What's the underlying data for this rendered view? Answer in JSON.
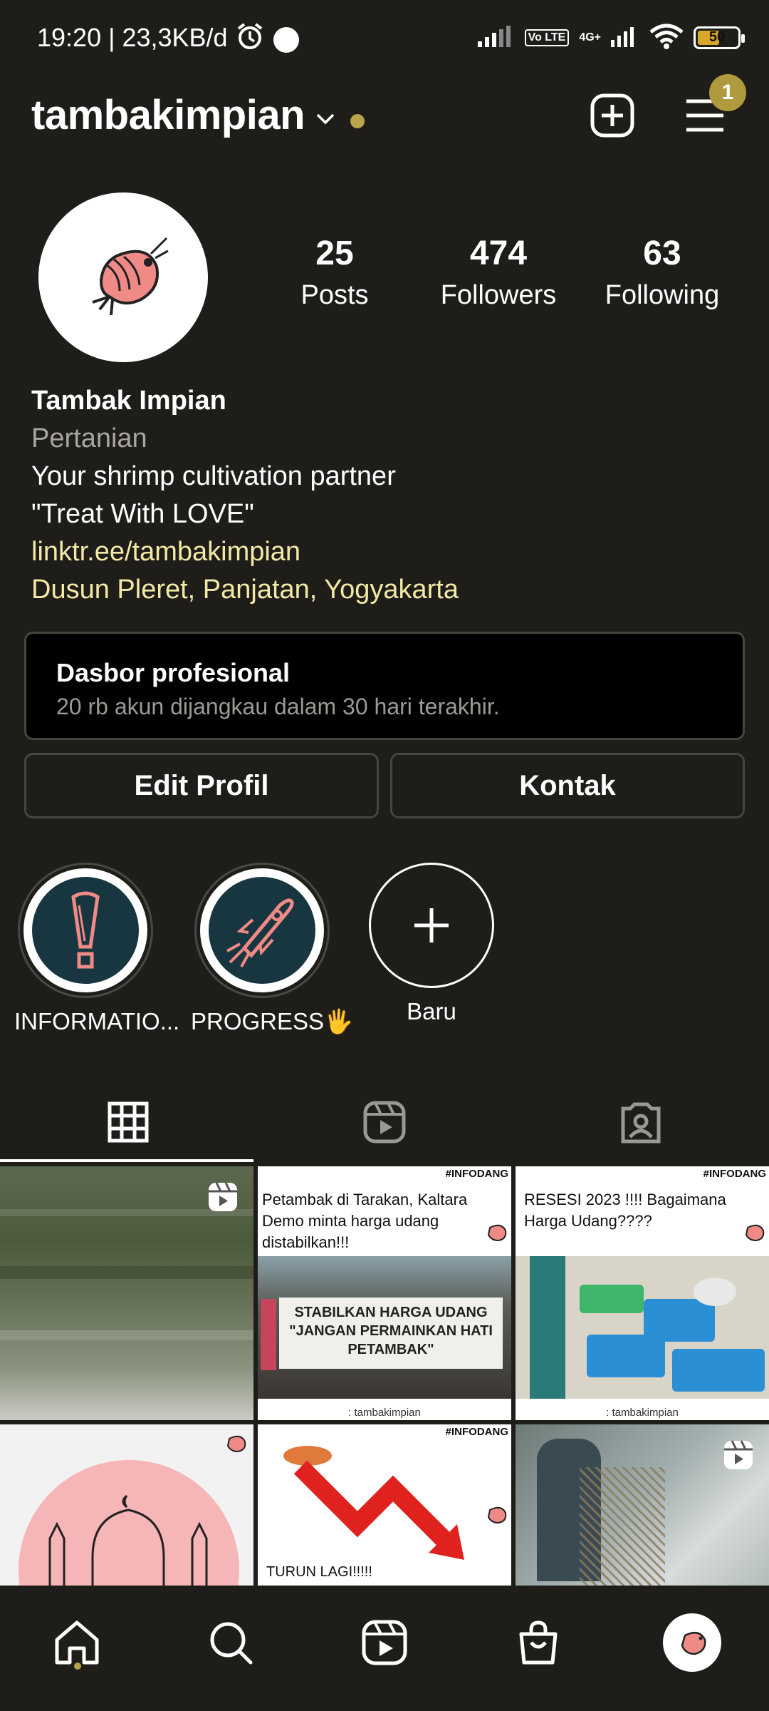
{
  "status_bar": {
    "time_speed": "19:20 | 23,3KB/d",
    "network_lte": "Vo LTE",
    "network_4g": "4G+",
    "battery": "50"
  },
  "header": {
    "username": "tambakimpian",
    "notification_count": "1"
  },
  "profile": {
    "stats": [
      {
        "value": "25",
        "label": "Posts"
      },
      {
        "value": "474",
        "label": "Followers"
      },
      {
        "value": "63",
        "label": "Following"
      }
    ],
    "name": "Tambak Impian",
    "category": "Pertanian",
    "bio_line1": "Your shrimp cultivation partner",
    "bio_line2": "\"Treat With LOVE\"",
    "link": "linktr.ee/tambakimpian",
    "address": "Dusun Pleret, Panjatan, Yogyakarta"
  },
  "dashboard": {
    "title": "Dasbor profesional",
    "subtitle": "20 rb akun dijangkau dalam 30 hari terakhir."
  },
  "buttons": {
    "edit": "Edit Profil",
    "contact": "Kontak"
  },
  "highlights": [
    {
      "label": "INFORMATIO..."
    },
    {
      "label": "PROGRESS🖐"
    },
    {
      "label": "Baru"
    }
  ],
  "posts": {
    "tag": "#INFODANG",
    "post2_text": "Petambak di Tarakan, Kaltara Demo minta harga udang distabilkan!!!",
    "post2_banner": "STABILKAN HARGA UDANG \"JANGAN PERMAINKAN HATI PETAMBAK\"",
    "post3_text": "RESESI 2023 !!!! Bagaimana Harga Udang????",
    "watermark": ": tambakimpian",
    "post5_text": "TURUN LAGI!!!!!"
  },
  "colors": {
    "background": "#1f1d1a",
    "accent_link": "#f3e9a4",
    "badge": "#b09a3e",
    "border": "#47453f"
  }
}
